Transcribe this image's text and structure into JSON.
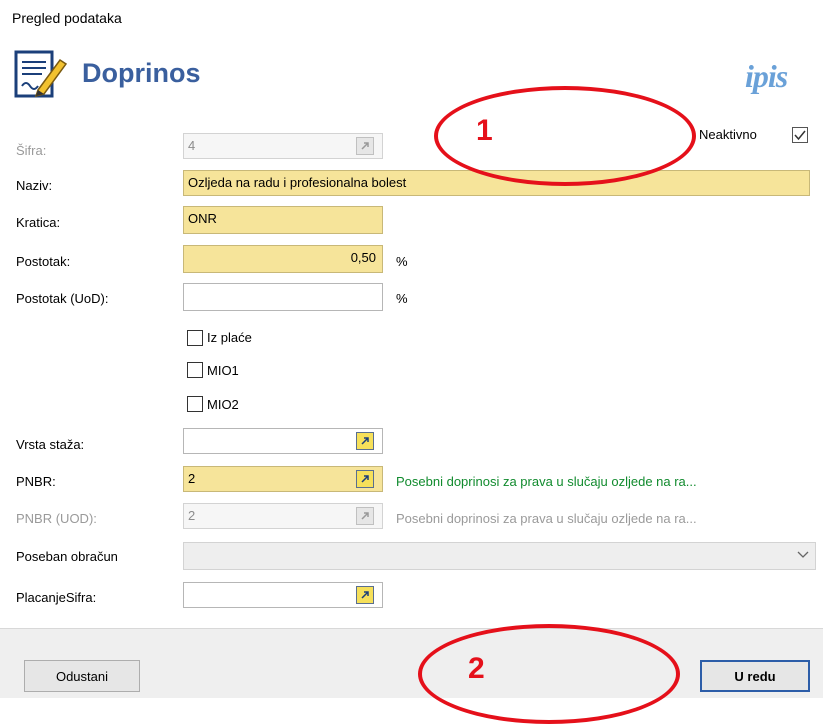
{
  "window": {
    "title": "Pregled podataka"
  },
  "header": {
    "title": "Doprinos",
    "logo_text": "ipis",
    "icon": "document-edit-icon"
  },
  "fields": {
    "sifra": {
      "label": "Šifra:",
      "value": "4",
      "disabled": true
    },
    "neaktivno": {
      "label": "Neaktivno",
      "checked": true
    },
    "naziv": {
      "label": "Naziv:",
      "value": "Ozljeda na radu i profesionalna bolest"
    },
    "kratica": {
      "label": "Kratica:",
      "value": "ONR"
    },
    "postotak": {
      "label": "Postotak:",
      "value": "0,50",
      "unit": "%"
    },
    "postotak_uod": {
      "label": "Postotak (UoD):",
      "value": "",
      "unit": "%"
    },
    "checkboxes": [
      {
        "label": "Iz plaće",
        "checked": false
      },
      {
        "label": "MIO1",
        "checked": false
      },
      {
        "label": "MIO2",
        "checked": false
      }
    ],
    "vrsta_staza": {
      "label": "Vrsta staža:",
      "value": ""
    },
    "pnbr": {
      "label": "PNBR:",
      "value": "2",
      "description": "Posebni doprinosi za prava u slučaju ozljede na ra..."
    },
    "pnbr_uod": {
      "label": "PNBR (UOD):",
      "value": "2",
      "description": "Posebni doprinosi za prava u slučaju ozljede na ra...",
      "disabled": true
    },
    "poseban_obracun": {
      "label": "Poseban obračun",
      "value": ""
    },
    "placanje_sifra": {
      "label": "PlacanjeSifra:",
      "value": ""
    }
  },
  "buttons": {
    "cancel": "Odustani",
    "ok": "U redu"
  },
  "annotations": {
    "first": "1",
    "second": "2"
  },
  "colors": {
    "title_blue": "#3a5f9e",
    "required_yellow": "#f6e49a",
    "hint_green": "#118b2e",
    "annotation_red": "#e5101a",
    "logo_blue": "#6aa1d8"
  }
}
